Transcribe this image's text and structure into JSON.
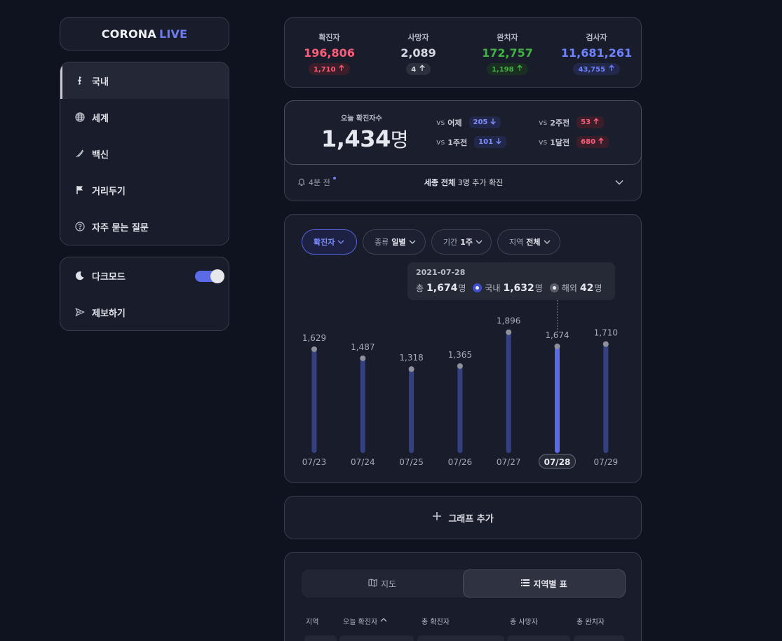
{
  "app": {
    "logo_main": "CORONA",
    "logo_accent": "LIVE"
  },
  "sidebar": {
    "items": [
      {
        "label": "국내",
        "icon": "korea-map-icon",
        "active": true
      },
      {
        "label": "세계",
        "icon": "globe-icon"
      },
      {
        "label": "백신",
        "icon": "syringe-icon"
      },
      {
        "label": "거리두기",
        "icon": "flag-icon"
      },
      {
        "label": "자주 묻는 질문",
        "icon": "question-circle-icon"
      }
    ],
    "settings": [
      {
        "label": "다크모드",
        "icon": "moon-icon",
        "toggle": true
      },
      {
        "label": "제보하기",
        "icon": "send-icon"
      }
    ]
  },
  "stats": [
    {
      "label": "확진자",
      "value": "196,806",
      "delta": "1,710",
      "color": "#ff5c7a",
      "delta_bg": "#3a1e2a"
    },
    {
      "label": "사망자",
      "value": "2,089",
      "delta": "4",
      "color": "#d7d9e0",
      "delta_bg": "#2c303c"
    },
    {
      "label": "완치자",
      "value": "172,757",
      "delta": "1,198",
      "color": "#3fb33f",
      "delta_bg": "#1b2e22"
    },
    {
      "label": "검사자",
      "value": "11,681,261",
      "delta": "43,755",
      "color": "#6f82ff",
      "delta_bg": "#22284a"
    }
  ],
  "today": {
    "label": "오늘 확진자수",
    "value": "1,434",
    "unit": "명",
    "compare": [
      {
        "prefix": "vs",
        "label": "어제",
        "value": "205",
        "dir": "down"
      },
      {
        "prefix": "vs",
        "label": "2주전",
        "value": "53",
        "dir": "up"
      },
      {
        "prefix": "vs",
        "label": "1주전",
        "value": "101",
        "dir": "down"
      },
      {
        "prefix": "vs",
        "label": "1달전",
        "value": "680",
        "dir": "up"
      }
    ],
    "notice_time": "4분 전",
    "notice_bold": "세종 전체",
    "notice_rest": "3명 추가 확진"
  },
  "chart_filters": [
    {
      "label": "확진자",
      "value": "",
      "active": true
    },
    {
      "label": "종류",
      "value": "일별"
    },
    {
      "label": "기간",
      "value": "1주"
    },
    {
      "label": "지역",
      "value": "전체"
    }
  ],
  "tooltip": {
    "date": "2021-07-28",
    "total_label": "총",
    "total_value": "1,674",
    "unit": "명",
    "domestic_label": "국내",
    "domestic_value": "1,632",
    "overseas_label": "해외",
    "overseas_value": "42"
  },
  "chart_data": {
    "type": "bar",
    "title": "",
    "categories": [
      "07/23",
      "07/24",
      "07/25",
      "07/26",
      "07/27",
      "07/28",
      "07/29"
    ],
    "series": [
      {
        "values": [
          1629,
          1487,
          1318,
          1365,
          1896,
          1674,
          1710
        ]
      }
    ],
    "data_labels": [
      "1,629",
      "1,487",
      "1,318",
      "1,365",
      "1,896",
      "1,674",
      "1,710"
    ],
    "highlight_index": 5,
    "ylim": [
      0,
      2150
    ],
    "bar_color": "#34407f",
    "highlight_color": "#5b6be8",
    "grid": false
  },
  "add_graph": {
    "label": "그래프 추가"
  },
  "table": {
    "tabs": [
      {
        "label": "지도",
        "icon": "map-icon"
      },
      {
        "label": "지역별 표",
        "icon": "list-icon",
        "active": true
      }
    ],
    "headers": [
      "지역",
      "오늘 확진자",
      "총 확진자",
      "총 사망자",
      "총 완치자"
    ]
  }
}
